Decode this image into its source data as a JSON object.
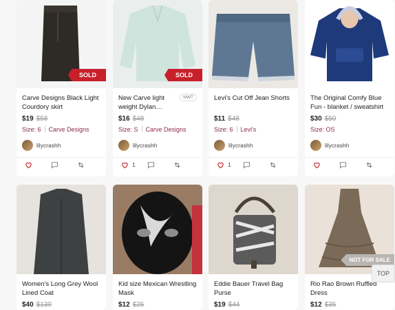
{
  "listings": [
    {
      "title": "Carve Designs Black Light Courdory skirt",
      "price": "$19",
      "original": "$58",
      "size": "Size: 6",
      "brand": "Carve Designs",
      "user": "lilycrashh",
      "likes": "",
      "badge": "SOLD"
    },
    {
      "title": "New Carve light weight Dylan…",
      "price": "$16",
      "original": "$48",
      "size": "Size: S",
      "brand": "Carve Designs",
      "user": "lilycrashh",
      "likes": "1",
      "badge": "SOLD",
      "tag": "NWT"
    },
    {
      "title": "Levi's Cut Off Jean Shorts",
      "price": "$11",
      "original": "$48",
      "size": "Size: 6",
      "brand": "Levi's",
      "user": "lilycrashh",
      "likes": "1"
    },
    {
      "title": "The Original Comfy Blue Fun - blanket / sweatshirt",
      "price": "$30",
      "original": "$50",
      "size": "Size: OS",
      "brand": "",
      "user": "lilycrashh",
      "likes": ""
    },
    {
      "title": "Women's Long Grey Wool Lined Coat",
      "price": "$40",
      "original": "$130"
    },
    {
      "title": "Kid size Mexican Wrestling Mask",
      "price": "$12",
      "original": "$25"
    },
    {
      "title": "Eddie Bauer Travel Bag Purse",
      "price": "$19",
      "original": "$44"
    },
    {
      "title": "Rio Rao Brown Ruffled Dress",
      "price": "$12",
      "original": "$35",
      "badge": "NOT FOR SALE"
    }
  ],
  "top_button": "TOP",
  "colors": {
    "sold": "#c8202b",
    "brand": "#8b2a54",
    "heart": "#c8202b"
  },
  "icons": [
    "heart-icon",
    "comment-icon",
    "share-icon"
  ]
}
